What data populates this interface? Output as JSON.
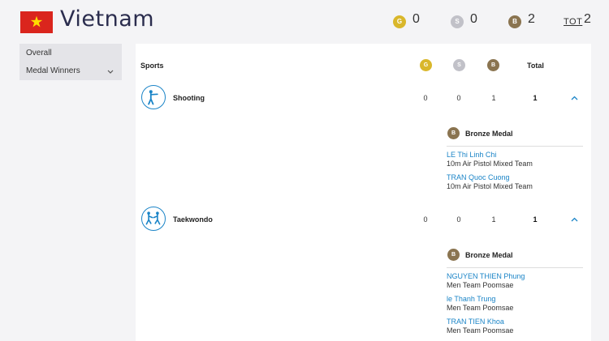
{
  "header": {
    "country": "Vietnam",
    "gold": {
      "badge": "G",
      "count": "0"
    },
    "silver": {
      "badge": "S",
      "count": "0"
    },
    "bronze": {
      "badge": "B",
      "count": "2"
    },
    "total": {
      "label": "TOT",
      "count": "2"
    }
  },
  "sidebar": {
    "items": [
      {
        "label": "Overall"
      },
      {
        "label": "Medal Winners"
      }
    ]
  },
  "table": {
    "headers": {
      "sports": "Sports",
      "gold": "G",
      "silver": "S",
      "bronze": "B",
      "total": "Total"
    },
    "sports": [
      {
        "name": "Shooting",
        "gold": "0",
        "silver": "0",
        "bronze": "1",
        "total": "1",
        "medal_group": {
          "badge": "B",
          "label": "Bronze Medal"
        },
        "winners": [
          {
            "athlete": "LE Thi Linh Chi",
            "event": "10m Air Pistol Mixed Team"
          },
          {
            "athlete": "TRAN Quoc Cuong",
            "event": "10m Air Pistol Mixed Team"
          }
        ]
      },
      {
        "name": "Taekwondo",
        "gold": "0",
        "silver": "0",
        "bronze": "1",
        "total": "1",
        "medal_group": {
          "badge": "B",
          "label": "Bronze Medal"
        },
        "winners": [
          {
            "athlete": "NGUYEN THIEN Phung",
            "event": "Men Team Poomsae"
          },
          {
            "athlete": "le Thanh Trung",
            "event": "Men Team Poomsae"
          },
          {
            "athlete": "TRAN TIEN Khoa",
            "event": "Men Team Poomsae"
          }
        ]
      }
    ]
  },
  "colors": {
    "gold": "#d9b72b",
    "silver": "#c1c1c8",
    "bronze": "#8a7450",
    "accent": "#1a84c7",
    "flag_red": "#da251d",
    "flag_star": "#ffdd00"
  },
  "icons": {
    "flag": "vietnam-flag-icon",
    "shooting": "shooting-sport-icon",
    "taekwondo": "taekwondo-sport-icon",
    "toggle": "chevron-up-icon",
    "dropdown": "chevron-down-icon"
  }
}
